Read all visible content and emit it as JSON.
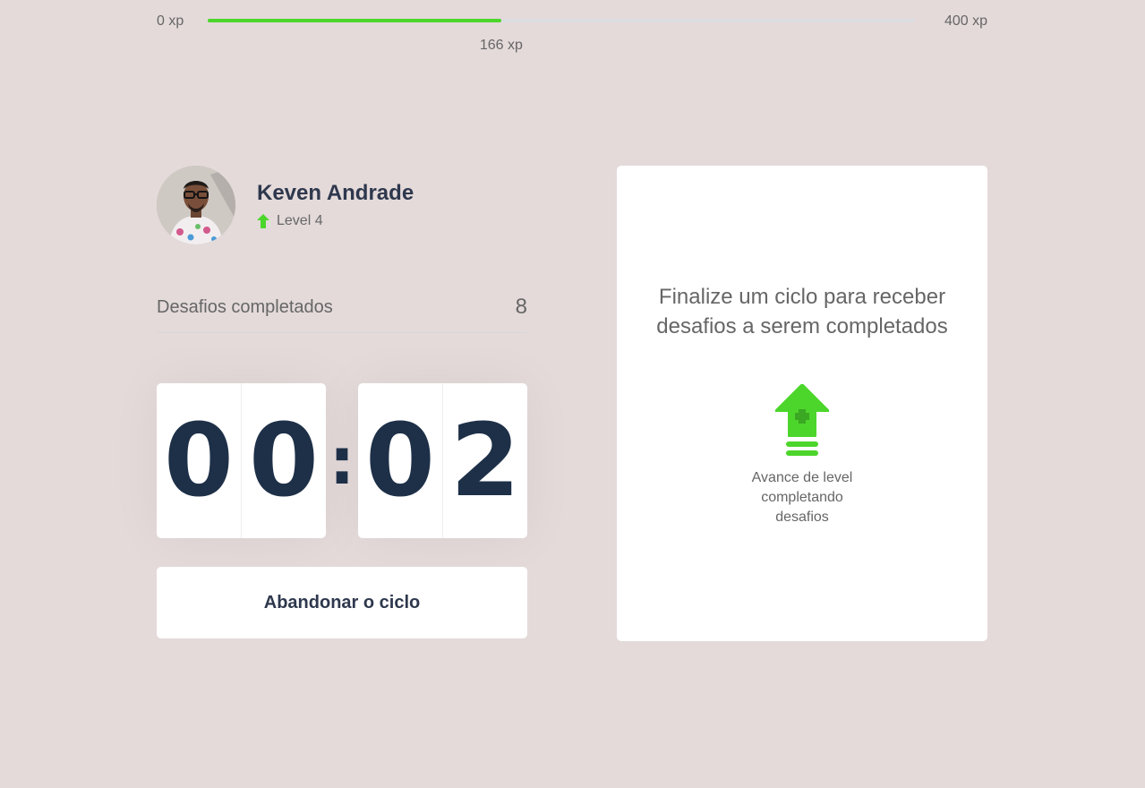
{
  "xp_bar": {
    "min_label": "0 xp",
    "max_label": "400 xp",
    "current_label": "166 xp",
    "current_xp": 166,
    "max_xp": 400,
    "fill_fraction": 0.415,
    "fill_color": "#4cd62b"
  },
  "profile": {
    "name": "Keven Andrade",
    "level_label": "Level 4",
    "level_icon": "level-up-arrow-icon",
    "avatar_icon": "user-avatar"
  },
  "completed_challenges": {
    "label": "Desafios completados",
    "value": "8"
  },
  "countdown": {
    "minutes": [
      "0",
      "0"
    ],
    "separator": ":",
    "seconds": [
      "0",
      "2"
    ]
  },
  "abandon_button": {
    "label": "Abandonar o ciclo"
  },
  "challenge_box": {
    "title": "Finalize um ciclo para receber desafios a serem completados",
    "icon": "level-up-icon",
    "text": "Avance de level completando desafios"
  },
  "colors": {
    "background": "#e4dada",
    "accent_green": "#4cd62b",
    "text_dark": "#2e384d",
    "text_muted": "#666666"
  }
}
